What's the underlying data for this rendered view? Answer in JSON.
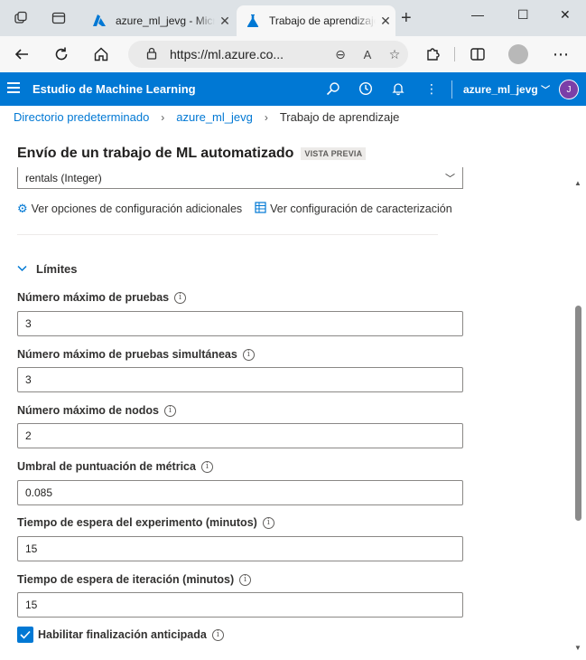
{
  "browser": {
    "tabs": [
      {
        "title": "azure_ml_jevg - Microsoft Azure",
        "active": false
      },
      {
        "title": "Trabajo de aprendizaje",
        "active": true
      }
    ],
    "url": "https://ml.azure.co..."
  },
  "app": {
    "brand": "Estudio de Machine Learning",
    "workspace": "azure_ml_jevg",
    "user_initial": "J"
  },
  "breadcrumb": {
    "items": [
      "Directorio predeterminado",
      "azure_ml_jevg",
      "Trabajo de aprendizaje"
    ]
  },
  "page": {
    "title": "Envío de un trabajo de ML automatizado",
    "badge": "VISTA PREVIA"
  },
  "target_select": {
    "value": "rentals (Integer)"
  },
  "links": {
    "additional_config": "Ver opciones de configuración adicionales",
    "featurization": "Ver configuración de caracterización"
  },
  "limits": {
    "section_title": "Límites",
    "fields": [
      {
        "label": "Número máximo de pruebas",
        "value": "3"
      },
      {
        "label": "Número máximo de pruebas simultáneas",
        "value": "3"
      },
      {
        "label": "Número máximo de nodos",
        "value": "2"
      },
      {
        "label": "Umbral de puntuación de métrica",
        "value": "0.085"
      },
      {
        "label": "Tiempo de espera del experimento (minutos)",
        "value": "15"
      },
      {
        "label": "Tiempo de espera de iteración (minutos)",
        "value": "15"
      }
    ],
    "early_termination": {
      "label": "Habilitar finalización anticipada",
      "checked": true
    }
  },
  "colors": {
    "accent": "#0078d4"
  }
}
